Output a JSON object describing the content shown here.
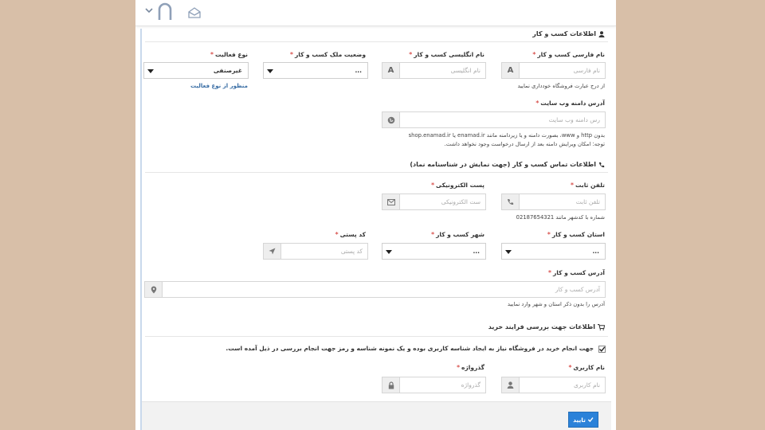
{
  "topbar": {
    "icons": [
      "chevron-down-icon",
      "avatar-icon",
      "mail-open-icon"
    ]
  },
  "sections": {
    "business_info": "اطلاعات کسب و کار",
    "contact_info": "اطلاعات تماس کسب و کار (جهت نمایش در شناسنامه نماد)",
    "review_info": "اطلاعات جهت بررسی فرایند خرید"
  },
  "fields": {
    "name_fa": {
      "label": "نام فارسی کسب و کار",
      "placeholder": "نام فارسی",
      "help": "از درج عبارت فروشگاه خودداری نمایید"
    },
    "name_en": {
      "label": "نام انگلیسی کسب و کار",
      "placeholder": "نام انگلیسی"
    },
    "ownership": {
      "label": "وضعیت ملک کسب و کار",
      "value": "..."
    },
    "activity_type": {
      "label": "نوع فعالیت",
      "value": "غیرصنفی",
      "link": "منظور از نوع فعالیت"
    },
    "website": {
      "label": "آدرس دامنه وب سایت",
      "placeholder": "رس دامنه وب سایت",
      "help1": "بدون http و www، بصورت دامنه و یا زیردامنه مانند enamad.ir یا shop.enamad.ir",
      "help2": "توجه: امکان ویرایش دامنه بعد از ارسال درخواست وجود نخواهد داشت."
    },
    "phone": {
      "label": "تلفن ثابت",
      "placeholder": "تلفن ثابت",
      "help": "شماره با کدشهر مانند 02187654321"
    },
    "email": {
      "label": "پست الکترونیکی",
      "placeholder": "ست الکترونیکی"
    },
    "province": {
      "label": "استان کسب و کار",
      "value": "..."
    },
    "city": {
      "label": "شهر کسب و کار",
      "value": "..."
    },
    "postal": {
      "label": "کد پستی",
      "placeholder": "کد پستی"
    },
    "address": {
      "label": "آدرس کسب و کار",
      "placeholder": "آدرس کسب و کار",
      "help": "آدرس را بدون ذکر استان و شهر وارد نمایید"
    },
    "username": {
      "label": "نام کاربری",
      "placeholder": "نام کاربری"
    },
    "password": {
      "label": "گذرواژه",
      "placeholder": "گذرواژه"
    }
  },
  "required_mark": "*",
  "review_checkbox": {
    "checked": true,
    "text": "جهت انجام خرید در فروشگاه نیاز به ایجاد شناسه کاربری بوده و یک نمونه شناسه و رمز جهت انجام بررسی در ذیل آمده است."
  },
  "submit_label": "تایید",
  "colors": {
    "accent": "#2b82d9",
    "required": "#d9534f",
    "link": "#3a6ea5",
    "backdrop": "#d8bfa8"
  }
}
